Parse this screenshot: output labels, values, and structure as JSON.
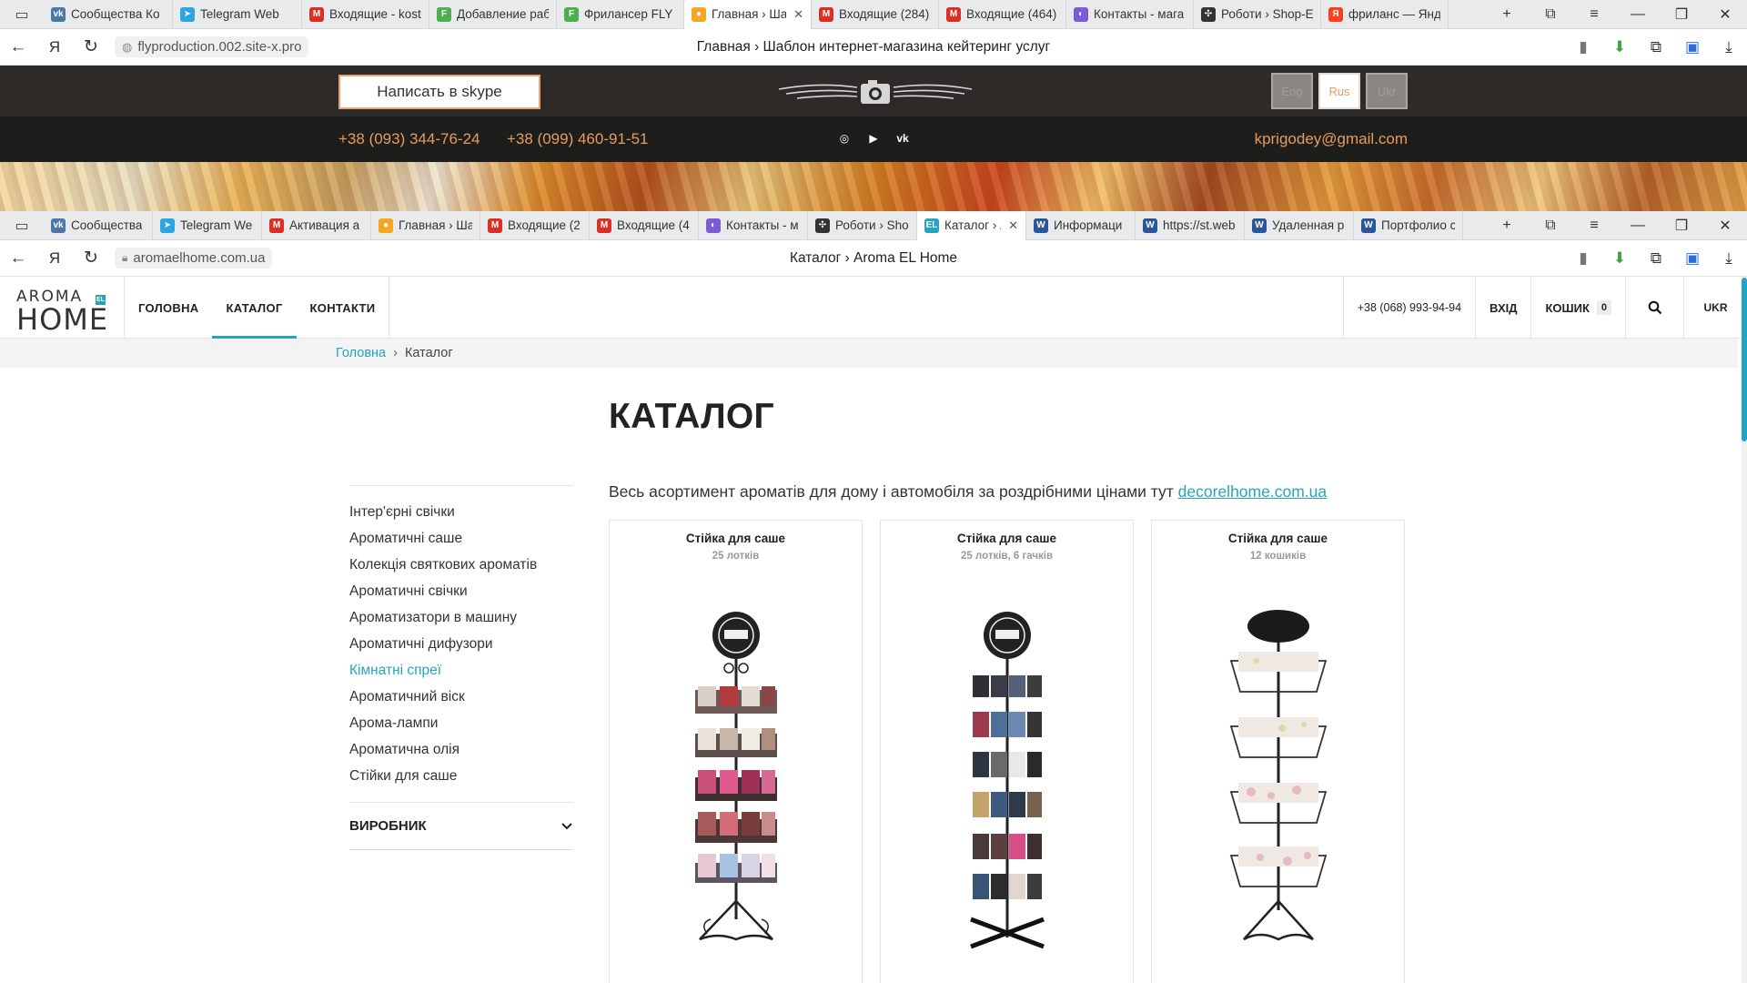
{
  "browser1": {
    "tabs": [
      {
        "label": "Сообщества Ко",
        "icon": "vk-icon",
        "color": "#4a76a8",
        "glyph": "vk"
      },
      {
        "label": "Telegram Web",
        "icon": "telegram-icon",
        "color": "#2ca5e0",
        "glyph": "➤"
      },
      {
        "label": "Входящие - kost",
        "icon": "gmail-icon",
        "color": "#d93025",
        "glyph": "M"
      },
      {
        "label": "Добавление раб",
        "icon": "doc-icon",
        "color": "#4caf50",
        "glyph": "F"
      },
      {
        "label": "Фрилансер FLY p",
        "icon": "doc-icon",
        "color": "#4caf50",
        "glyph": "F"
      },
      {
        "label": "Главная › Шаб",
        "icon": "pin-icon",
        "color": "#f6a623",
        "glyph": "●",
        "active": true
      },
      {
        "label": "Входящие (284)",
        "icon": "gmail-icon",
        "color": "#d93025",
        "glyph": "M"
      },
      {
        "label": "Входящие (464)",
        "icon": "gmail-icon",
        "color": "#d93025",
        "glyph": "M"
      },
      {
        "label": "Контакты - мага",
        "icon": "shop-icon",
        "color": "#7b5cd6",
        "glyph": "◐"
      },
      {
        "label": "Роботи › Shop-E",
        "icon": "puzzle-icon",
        "color": "#333333",
        "glyph": "✣"
      },
      {
        "label": "фриланс — Янде",
        "icon": "yandex-icon",
        "color": "#fc3f1d",
        "glyph": "Я"
      }
    ],
    "url": "flyproduction.002.site-x.pro",
    "title": "Главная › Шаблон интернет-магазина кейтеринг услуг"
  },
  "fly": {
    "skype_label": "Написать в skype",
    "langs": [
      "Eng",
      "Rus",
      "Ukr"
    ],
    "active_lang": "Rus",
    "phone1": "+38 (093) 344-76-24",
    "phone2": "+38 (099) 460-91-51",
    "email": "kprigodey@gmail.com",
    "accent": "#e79b5f"
  },
  "browser2": {
    "tabs": [
      {
        "label": "Сообщества",
        "icon": "vk-icon",
        "color": "#4a76a8",
        "glyph": "vk"
      },
      {
        "label": "Telegram We",
        "icon": "telegram-icon",
        "color": "#2ca5e0",
        "glyph": "➤"
      },
      {
        "label": "Активация а",
        "icon": "gmail-icon",
        "color": "#d93025",
        "glyph": "M"
      },
      {
        "label": "Главная › Ша",
        "icon": "pin-icon",
        "color": "#f6a623",
        "glyph": "●"
      },
      {
        "label": "Входящие (2",
        "icon": "gmail-icon",
        "color": "#d93025",
        "glyph": "M"
      },
      {
        "label": "Входящие (4",
        "icon": "gmail-icon",
        "color": "#d93025",
        "glyph": "M"
      },
      {
        "label": "Контакты - м",
        "icon": "shop-icon",
        "color": "#7b5cd6",
        "glyph": "◐"
      },
      {
        "label": "Роботи › Sho",
        "icon": "puzzle-icon",
        "color": "#333333",
        "glyph": "✣"
      },
      {
        "label": "Каталог › A",
        "icon": "el-icon",
        "color": "#27a3c1",
        "glyph": "EL",
        "active": true
      },
      {
        "label": "Информаци",
        "icon": "word-icon",
        "color": "#2b579a",
        "glyph": "W"
      },
      {
        "label": "https://st.web",
        "icon": "word-icon",
        "color": "#2b579a",
        "glyph": "W"
      },
      {
        "label": "Удаленная р",
        "icon": "word-icon",
        "color": "#2b579a",
        "glyph": "W"
      },
      {
        "label": "Портфолио с",
        "icon": "word-icon",
        "color": "#2b579a",
        "glyph": "W"
      }
    ],
    "url": "aromaelhome.com.ua",
    "title": "Каталог › Aroma EL Home"
  },
  "aroma": {
    "logo_top": "AROMA",
    "logo_bottom": "HOME",
    "logo_badge": "EL",
    "nav": [
      "ГОЛОВНА",
      "КАТАЛОГ",
      "КОНТАКТИ"
    ],
    "active_nav": "КАТАЛОГ",
    "phone": "+38 (068) 993-94-94",
    "login": "ВХІД",
    "cart_label": "КОШИК",
    "cart_count": "0",
    "lang": "UKR",
    "breadcrumb": {
      "home": "Головна",
      "sep": "›",
      "current": "Каталог"
    },
    "heading": "КАТАЛОГ",
    "intro_text": "Весь асортимент ароматів для дому і автомобіля за роздрібними цінами тут",
    "intro_link": "decorelhome.com.ua",
    "categories": [
      "Інтер'єрні свічки",
      "Ароматичні саше",
      "Колекція святкових ароматів",
      "Ароматичні свічки",
      "Ароматизатори в машину",
      "Ароматичні дифузори",
      "Кімнатні спреї",
      "Ароматичний віск",
      "Арома-лампи",
      "Ароматична олія",
      "Стійки для саше"
    ],
    "highlighted_category": "Кімнатні спреї",
    "filter_label": "ВИРОБНИК",
    "accent": "#27a3c1",
    "products": [
      {
        "title": "Стійка для саше",
        "subtitle": "25 лотків"
      },
      {
        "title": "Стійка для саше",
        "subtitle": "25 лотків, 6 гачків"
      },
      {
        "title": "Стійка для саше",
        "subtitle": "12 кошиків"
      }
    ]
  }
}
